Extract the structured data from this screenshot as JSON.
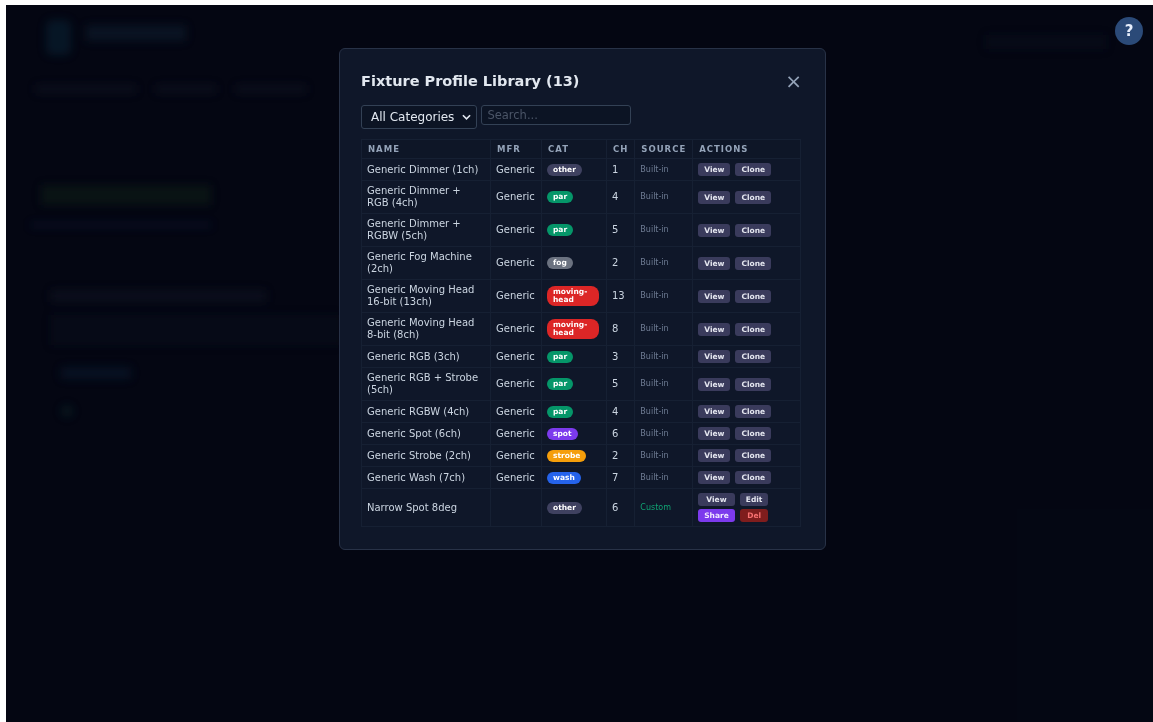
{
  "help_button": {
    "label": "?"
  },
  "modal": {
    "title": "Fixture Profile Library (13)",
    "close": "×",
    "category_select": {
      "value": "All Categories"
    },
    "search": {
      "placeholder": "Search..."
    },
    "table": {
      "columns": [
        "NAME",
        "MFR",
        "CAT",
        "CH",
        "SOURCE",
        "ACTIONS"
      ],
      "rows": [
        {
          "name": "Generic Dimmer (1ch)",
          "mfr": "Generic",
          "cat": {
            "label": "other",
            "color": "#3f4160"
          },
          "ch": "1",
          "source": {
            "text": "Built-in",
            "kind": "builtin"
          },
          "actions": [
            {
              "label": "View",
              "kind": "neutral"
            },
            {
              "label": "Clone",
              "kind": "neutral"
            }
          ]
        },
        {
          "name": "Generic Dimmer + RGB (4ch)",
          "mfr": "Generic",
          "cat": {
            "label": "par",
            "color": "#059669"
          },
          "ch": "4",
          "source": {
            "text": "Built-in",
            "kind": "builtin"
          },
          "actions": [
            {
              "label": "View",
              "kind": "neutral"
            },
            {
              "label": "Clone",
              "kind": "neutral"
            }
          ]
        },
        {
          "name": "Generic Dimmer + RGBW (5ch)",
          "mfr": "Generic",
          "cat": {
            "label": "par",
            "color": "#059669"
          },
          "ch": "5",
          "source": {
            "text": "Built-in",
            "kind": "builtin"
          },
          "actions": [
            {
              "label": "View",
              "kind": "neutral"
            },
            {
              "label": "Clone",
              "kind": "neutral"
            }
          ]
        },
        {
          "name": "Generic Fog Machine (2ch)",
          "mfr": "Generic",
          "cat": {
            "label": "fog",
            "color": "#6b7280"
          },
          "ch": "2",
          "source": {
            "text": "Built-in",
            "kind": "builtin"
          },
          "actions": [
            {
              "label": "View",
              "kind": "neutral"
            },
            {
              "label": "Clone",
              "kind": "neutral"
            }
          ]
        },
        {
          "name": "Generic Moving Head 16-bit (13ch)",
          "mfr": "Generic",
          "cat": {
            "label": "moving-head",
            "color": "#dc2626"
          },
          "ch": "13",
          "source": {
            "text": "Built-in",
            "kind": "builtin"
          },
          "actions": [
            {
              "label": "View",
              "kind": "neutral"
            },
            {
              "label": "Clone",
              "kind": "neutral"
            }
          ]
        },
        {
          "name": "Generic Moving Head 8-bit (8ch)",
          "mfr": "Generic",
          "cat": {
            "label": "moving-head",
            "color": "#dc2626"
          },
          "ch": "8",
          "source": {
            "text": "Built-in",
            "kind": "builtin"
          },
          "actions": [
            {
              "label": "View",
              "kind": "neutral"
            },
            {
              "label": "Clone",
              "kind": "neutral"
            }
          ]
        },
        {
          "name": "Generic RGB (3ch)",
          "mfr": "Generic",
          "cat": {
            "label": "par",
            "color": "#059669"
          },
          "ch": "3",
          "source": {
            "text": "Built-in",
            "kind": "builtin"
          },
          "actions": [
            {
              "label": "View",
              "kind": "neutral"
            },
            {
              "label": "Clone",
              "kind": "neutral"
            }
          ]
        },
        {
          "name": "Generic RGB + Strobe (5ch)",
          "mfr": "Generic",
          "cat": {
            "label": "par",
            "color": "#059669"
          },
          "ch": "5",
          "source": {
            "text": "Built-in",
            "kind": "builtin"
          },
          "actions": [
            {
              "label": "View",
              "kind": "neutral"
            },
            {
              "label": "Clone",
              "kind": "neutral"
            }
          ]
        },
        {
          "name": "Generic RGBW (4ch)",
          "mfr": "Generic",
          "cat": {
            "label": "par",
            "color": "#059669"
          },
          "ch": "4",
          "source": {
            "text": "Built-in",
            "kind": "builtin"
          },
          "actions": [
            {
              "label": "View",
              "kind": "neutral"
            },
            {
              "label": "Clone",
              "kind": "neutral"
            }
          ]
        },
        {
          "name": "Generic Spot (6ch)",
          "mfr": "Generic",
          "cat": {
            "label": "spot",
            "color": "#7c3aed"
          },
          "ch": "6",
          "source": {
            "text": "Built-in",
            "kind": "builtin"
          },
          "actions": [
            {
              "label": "View",
              "kind": "neutral"
            },
            {
              "label": "Clone",
              "kind": "neutral"
            }
          ]
        },
        {
          "name": "Generic Strobe (2ch)",
          "mfr": "Generic",
          "cat": {
            "label": "strobe",
            "color": "#f59e0b"
          },
          "ch": "2",
          "source": {
            "text": "Built-in",
            "kind": "builtin"
          },
          "actions": [
            {
              "label": "View",
              "kind": "neutral"
            },
            {
              "label": "Clone",
              "kind": "neutral"
            }
          ]
        },
        {
          "name": "Generic Wash (7ch)",
          "mfr": "Generic",
          "cat": {
            "label": "wash",
            "color": "#2563eb"
          },
          "ch": "7",
          "source": {
            "text": "Built-in",
            "kind": "builtin"
          },
          "actions": [
            {
              "label": "View",
              "kind": "neutral"
            },
            {
              "label": "Clone",
              "kind": "neutral"
            }
          ]
        },
        {
          "name": "Narrow Spot 8deg",
          "cat": {
            "label": "other",
            "color": "#3f4160"
          },
          "ch": "6",
          "source": {
            "text": "Custom",
            "kind": "custom"
          },
          "actions": [
            {
              "label": "View",
              "kind": "neutral"
            },
            {
              "label": "Edit",
              "kind": "neutral"
            },
            {
              "label": "Share",
              "kind": "share"
            },
            {
              "label": "Del",
              "kind": "danger"
            }
          ]
        }
      ]
    }
  }
}
